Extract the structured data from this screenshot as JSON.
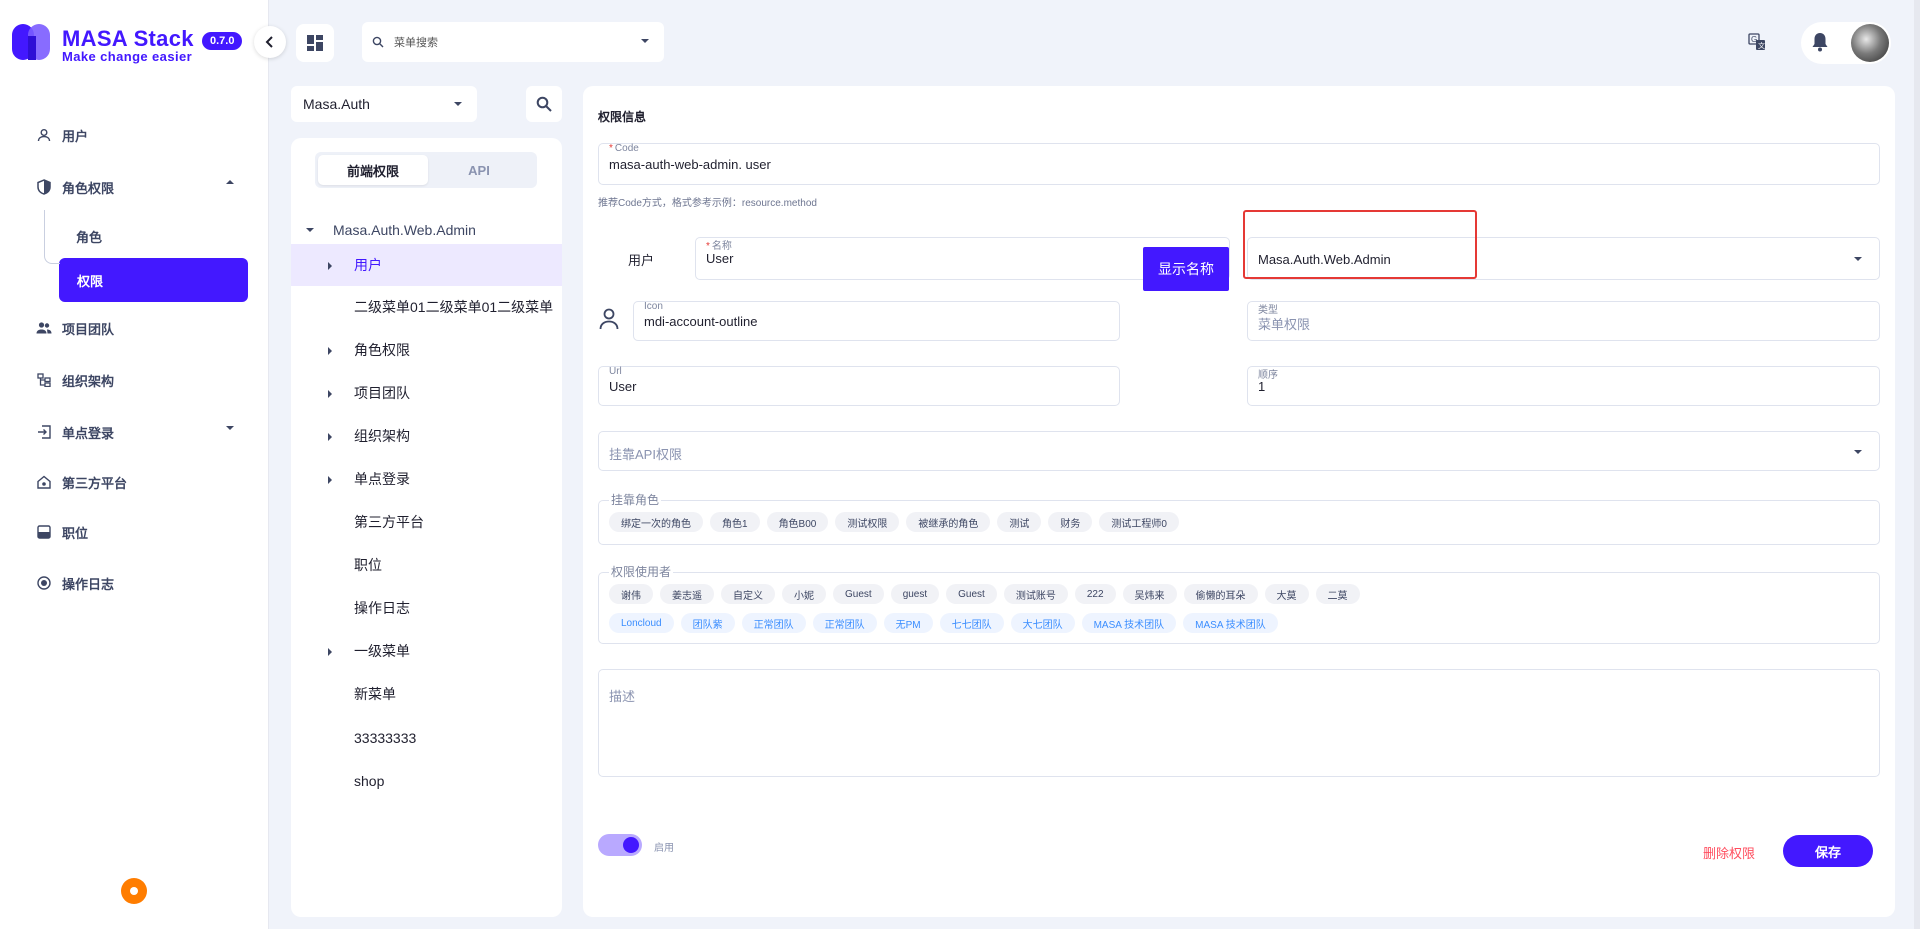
{
  "brand": {
    "title": "MASA Stack",
    "subtitle": "Make change easier",
    "version": "0.7.0",
    "color": "#4318ff"
  },
  "sidebar": {
    "items": [
      {
        "label": "用户",
        "icon": "person-outline-icon"
      },
      {
        "label": "角色权限",
        "icon": "shield-icon",
        "expanded": true,
        "children": [
          {
            "label": "角色",
            "active": false
          },
          {
            "label": "权限",
            "active": true
          }
        ]
      },
      {
        "label": "项目团队",
        "icon": "people-icon"
      },
      {
        "label": "组织架构",
        "icon": "org-chart-icon"
      },
      {
        "label": "单点登录",
        "icon": "login-icon",
        "expandable": true
      },
      {
        "label": "第三方平台",
        "icon": "home-link-icon"
      },
      {
        "label": "职位",
        "icon": "badge-icon"
      },
      {
        "label": "操作日志",
        "icon": "record-icon"
      }
    ]
  },
  "topbar": {
    "search_placeholder": "菜单搜索"
  },
  "tree": {
    "app_select": "Masa.Auth",
    "tabs": [
      {
        "label": "前端权限",
        "active": true
      },
      {
        "label": "API",
        "active": false
      }
    ],
    "root": "Masa.Auth.Web.Admin",
    "items": [
      {
        "label": "用户",
        "expandable": true,
        "selected": true
      },
      {
        "label": "二级菜单01二级菜单01二级菜单",
        "expandable": false,
        "selected": false
      },
      {
        "label": "角色权限",
        "expandable": true,
        "selected": false
      },
      {
        "label": "项目团队",
        "expandable": true,
        "selected": false
      },
      {
        "label": "组织架构",
        "expandable": true,
        "selected": false
      },
      {
        "label": "单点登录",
        "expandable": true,
        "selected": false
      },
      {
        "label": "第三方平台",
        "expandable": false,
        "selected": false
      },
      {
        "label": "职位",
        "expandable": false,
        "selected": false
      },
      {
        "label": "操作日志",
        "expandable": false,
        "selected": false
      },
      {
        "label": "一级菜单",
        "expandable": true,
        "selected": false
      },
      {
        "label": "新菜单",
        "expandable": false,
        "selected": false
      },
      {
        "label": "33333333",
        "expandable": false,
        "selected": false
      },
      {
        "label": "shop",
        "expandable": false,
        "selected": false
      }
    ]
  },
  "form": {
    "section_title": "权限信息",
    "code": {
      "label": "Code",
      "value": "masa-auth-web-admin. user"
    },
    "code_hint": "推荐Code方式，格式参考示例：resource.method",
    "name_prefix": "用户",
    "name": {
      "label": "名称",
      "value": "User"
    },
    "show_name_button": "显示名称",
    "parent_select": "Masa.Auth.Web.Admin",
    "icon": {
      "label": "Icon",
      "value": "mdi-account-outline"
    },
    "type": {
      "label": "类型",
      "value": "菜单权限"
    },
    "url": {
      "label": "Url",
      "value": "User"
    },
    "order": {
      "label": "顺序",
      "value": "1"
    },
    "api_permissions": {
      "placeholder": "挂靠API权限"
    },
    "roles": {
      "label": "挂靠角色",
      "chips": [
        "绑定一次的角色",
        "角色1",
        "角色B00",
        "测试权限",
        "被继承的角色",
        "测试",
        "财务",
        "测试工程师0"
      ]
    },
    "users": {
      "label": "权限使用者",
      "user_chips": [
        "谢伟",
        "姜志遥",
        "自定义",
        "小妮",
        "Guest",
        "guest",
        "Guest",
        "测试账号",
        "222",
        "吴炜来",
        "偷懒的耳朵",
        "大莫",
        "二莫"
      ],
      "team_chips": [
        "Loncloud",
        "团队紫",
        "正常团队",
        "正常团队",
        "无PM",
        "七七团队",
        "大七团队",
        "MASA 技术团队",
        "MASA 技术团队"
      ]
    },
    "description": {
      "placeholder": "描述"
    },
    "enabled_label": "启用",
    "enabled": true,
    "delete_label": "删除权限",
    "save_label": "保存"
  }
}
